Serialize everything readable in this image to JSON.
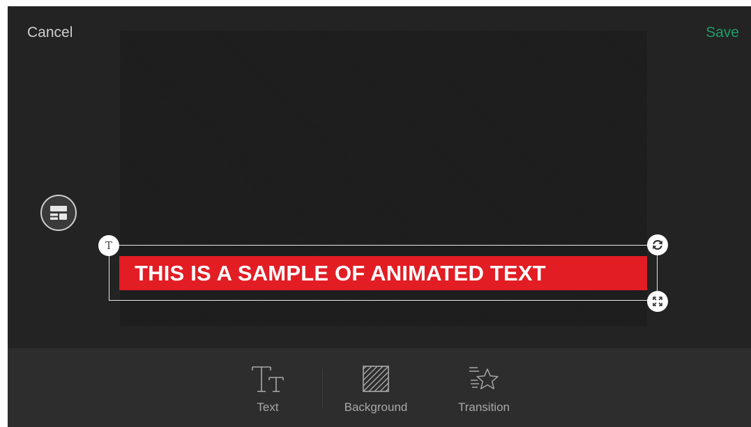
{
  "header": {
    "cancel_label": "Cancel",
    "save_label": "Save"
  },
  "overlay": {
    "text": "THIS IS A SAMPLE OF ANIMATED TEXT"
  },
  "handles": {
    "text_glyph": "T"
  },
  "toolbar": {
    "items": [
      {
        "label": "Text",
        "icon": "text-size-icon"
      },
      {
        "label": "Background",
        "icon": "background-hatch-icon"
      },
      {
        "label": "Transition",
        "icon": "star-transition-icon"
      }
    ]
  },
  "colors": {
    "save_accent": "#1f9c6c",
    "banner_red": "#e21d24",
    "app_background": "#232323",
    "toolbar_background": "#2d2d2d"
  }
}
